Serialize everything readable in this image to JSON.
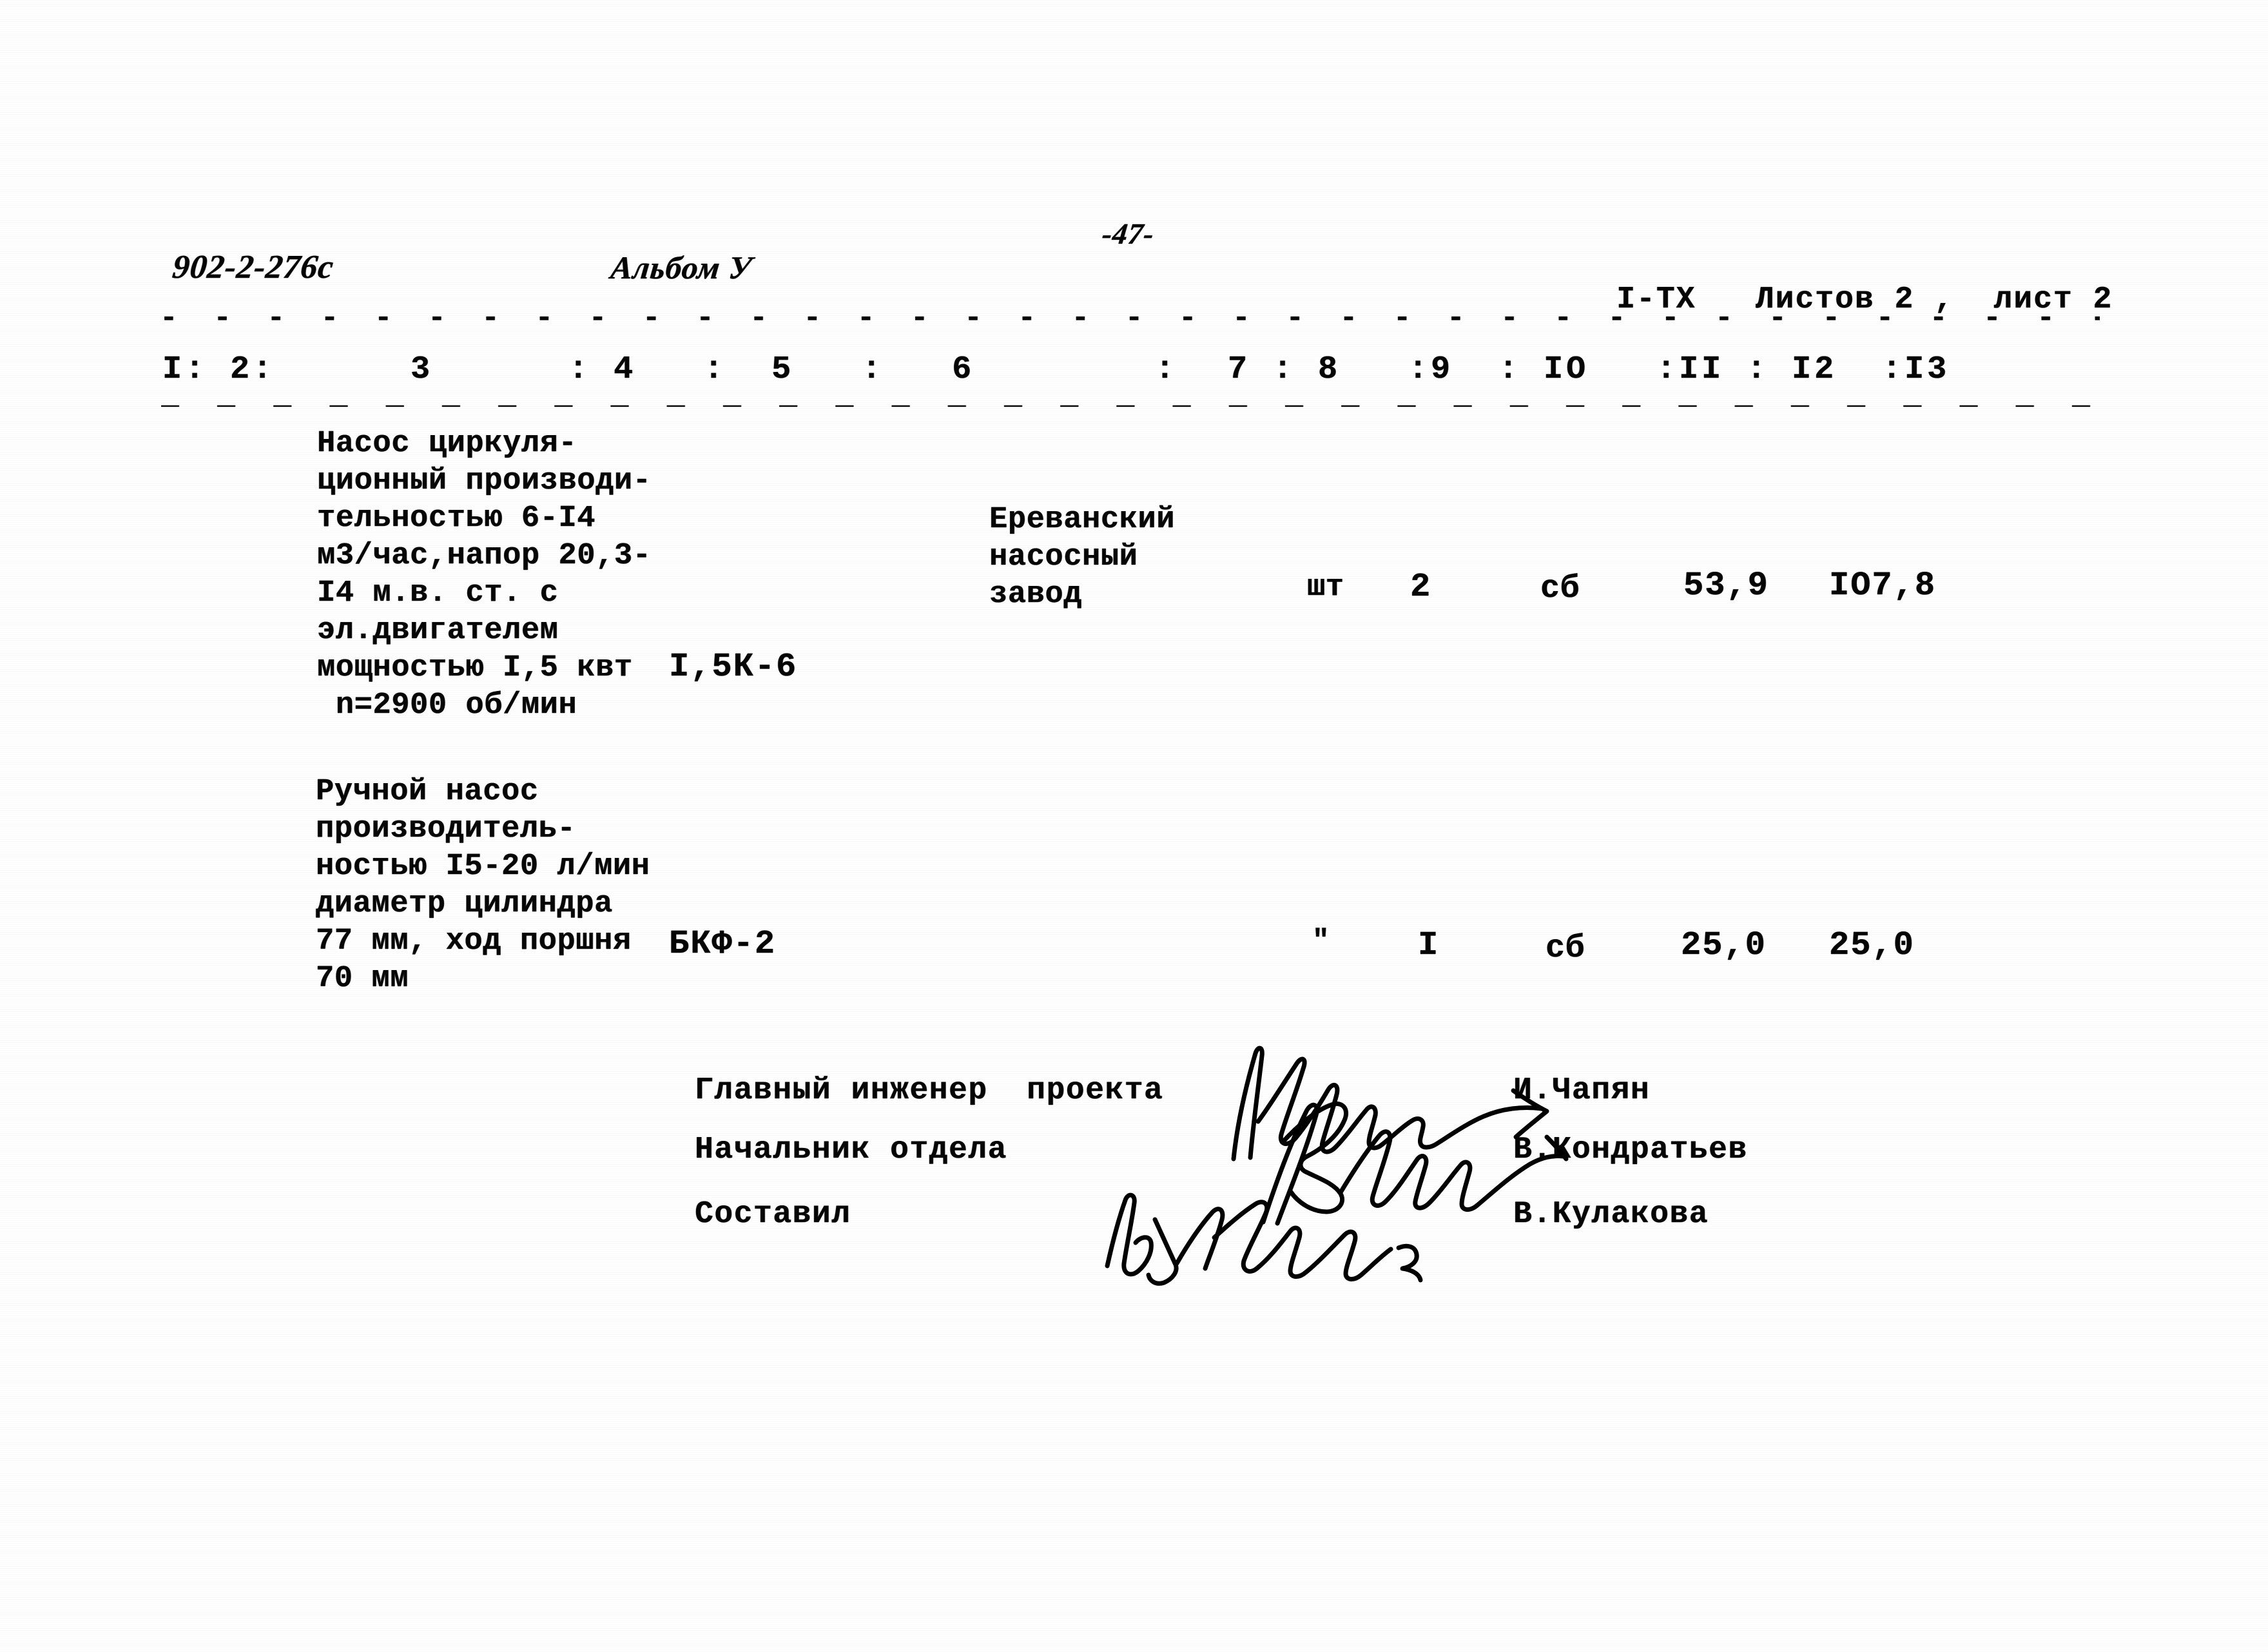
{
  "page": {
    "doc_code": "902-2-276с",
    "album": "Альбом У",
    "page_number": "-47-",
    "sheet_info": "I-ТХ   Листов 2 ,  лист 2"
  },
  "table": {
    "column_numbers_left": "I: 2:      3      : 4   :  5   :   6        :",
    "column_numbers_right": " 7 : 8   :9  : IO   :II : I2  :I3",
    "rule_dashes_top": "- - - - - - - - - - - - - - - - - - - - - - - - - - - - - - - - - - - - - - - - - - - - - - -",
    "rule_dashes_colnum": "_ _ _ _ _ _ _ _ _ _ _ _ _ _ _ _ _ _ _ _ _ _ _ _ _ _ _ _ _ _ _ _ _ _ _ _ _ _ _ _ _ _ _",
    "rows": [
      {
        "description": "Насос циркуля-\nционный производи-\nтельностью 6-I4\nм3/час,напор 20,3-\nI4 м.в. ст. с\nэл.двигателем\nмощностью I,5 квт\n n=2900 об/мин",
        "model": "I,5К-6",
        "manufacturer": "Ереванский\nнасосный\nзавод",
        "unit": "шт",
        "quantity": "2",
        "assembly": "сб",
        "unit_price": "53,9",
        "total_price": "IO7,8"
      },
      {
        "description": "Ручной насос\nпроизводитель-\nностью I5-20 л/мин\nдиаметр цилиндра\n77 мм, ход поршня\n70 мм",
        "model": "БКФ-2",
        "manufacturer": "\"",
        "unit": "",
        "quantity": "I",
        "assembly": "сб",
        "unit_price": "25,0",
        "total_price": "25,0"
      }
    ]
  },
  "signatures": {
    "rows": [
      {
        "role": "Главный инженер  проекта",
        "name": "И.Чапян"
      },
      {
        "role": "Начальник отдела",
        "name": "В.Кондратьев"
      },
      {
        "role": "Составил",
        "name": "В.Кулакова"
      }
    ]
  }
}
